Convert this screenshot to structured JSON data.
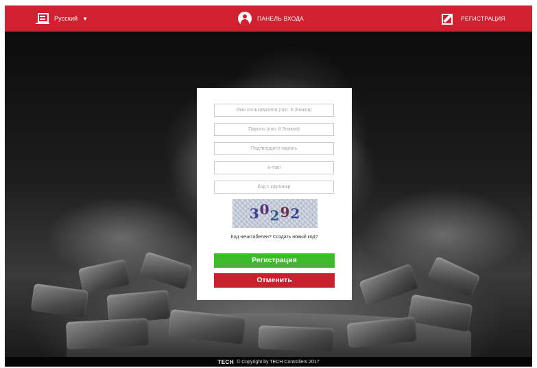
{
  "header": {
    "language_label": "Русский",
    "login_label": "ПАНЕЛЬ ВХОДА",
    "register_label": "РЕГИСТРАЦИЯ"
  },
  "form": {
    "username_placeholder": "Имя пользователя (min. 6 Знаков)",
    "password_placeholder": "Пароль (min. 8 Знаков)",
    "confirm_placeholder": "Подтвердите пароль",
    "email_placeholder": "e-mail",
    "captcha_placeholder": "Код с картинки",
    "captcha_digits": [
      "3",
      "0",
      "2",
      "9",
      "2"
    ],
    "reload_text": "Код нечитабелен? Создать новый код?",
    "register_button": "Регистрация",
    "cancel_button": "Отменить"
  },
  "footer": {
    "logo": "TECH",
    "copyright": "© Copyright by TECH Controllers 2017"
  },
  "colors": {
    "brand_red": "#d1202f",
    "green": "#3cba2a",
    "cancel_red": "#c8202c"
  }
}
